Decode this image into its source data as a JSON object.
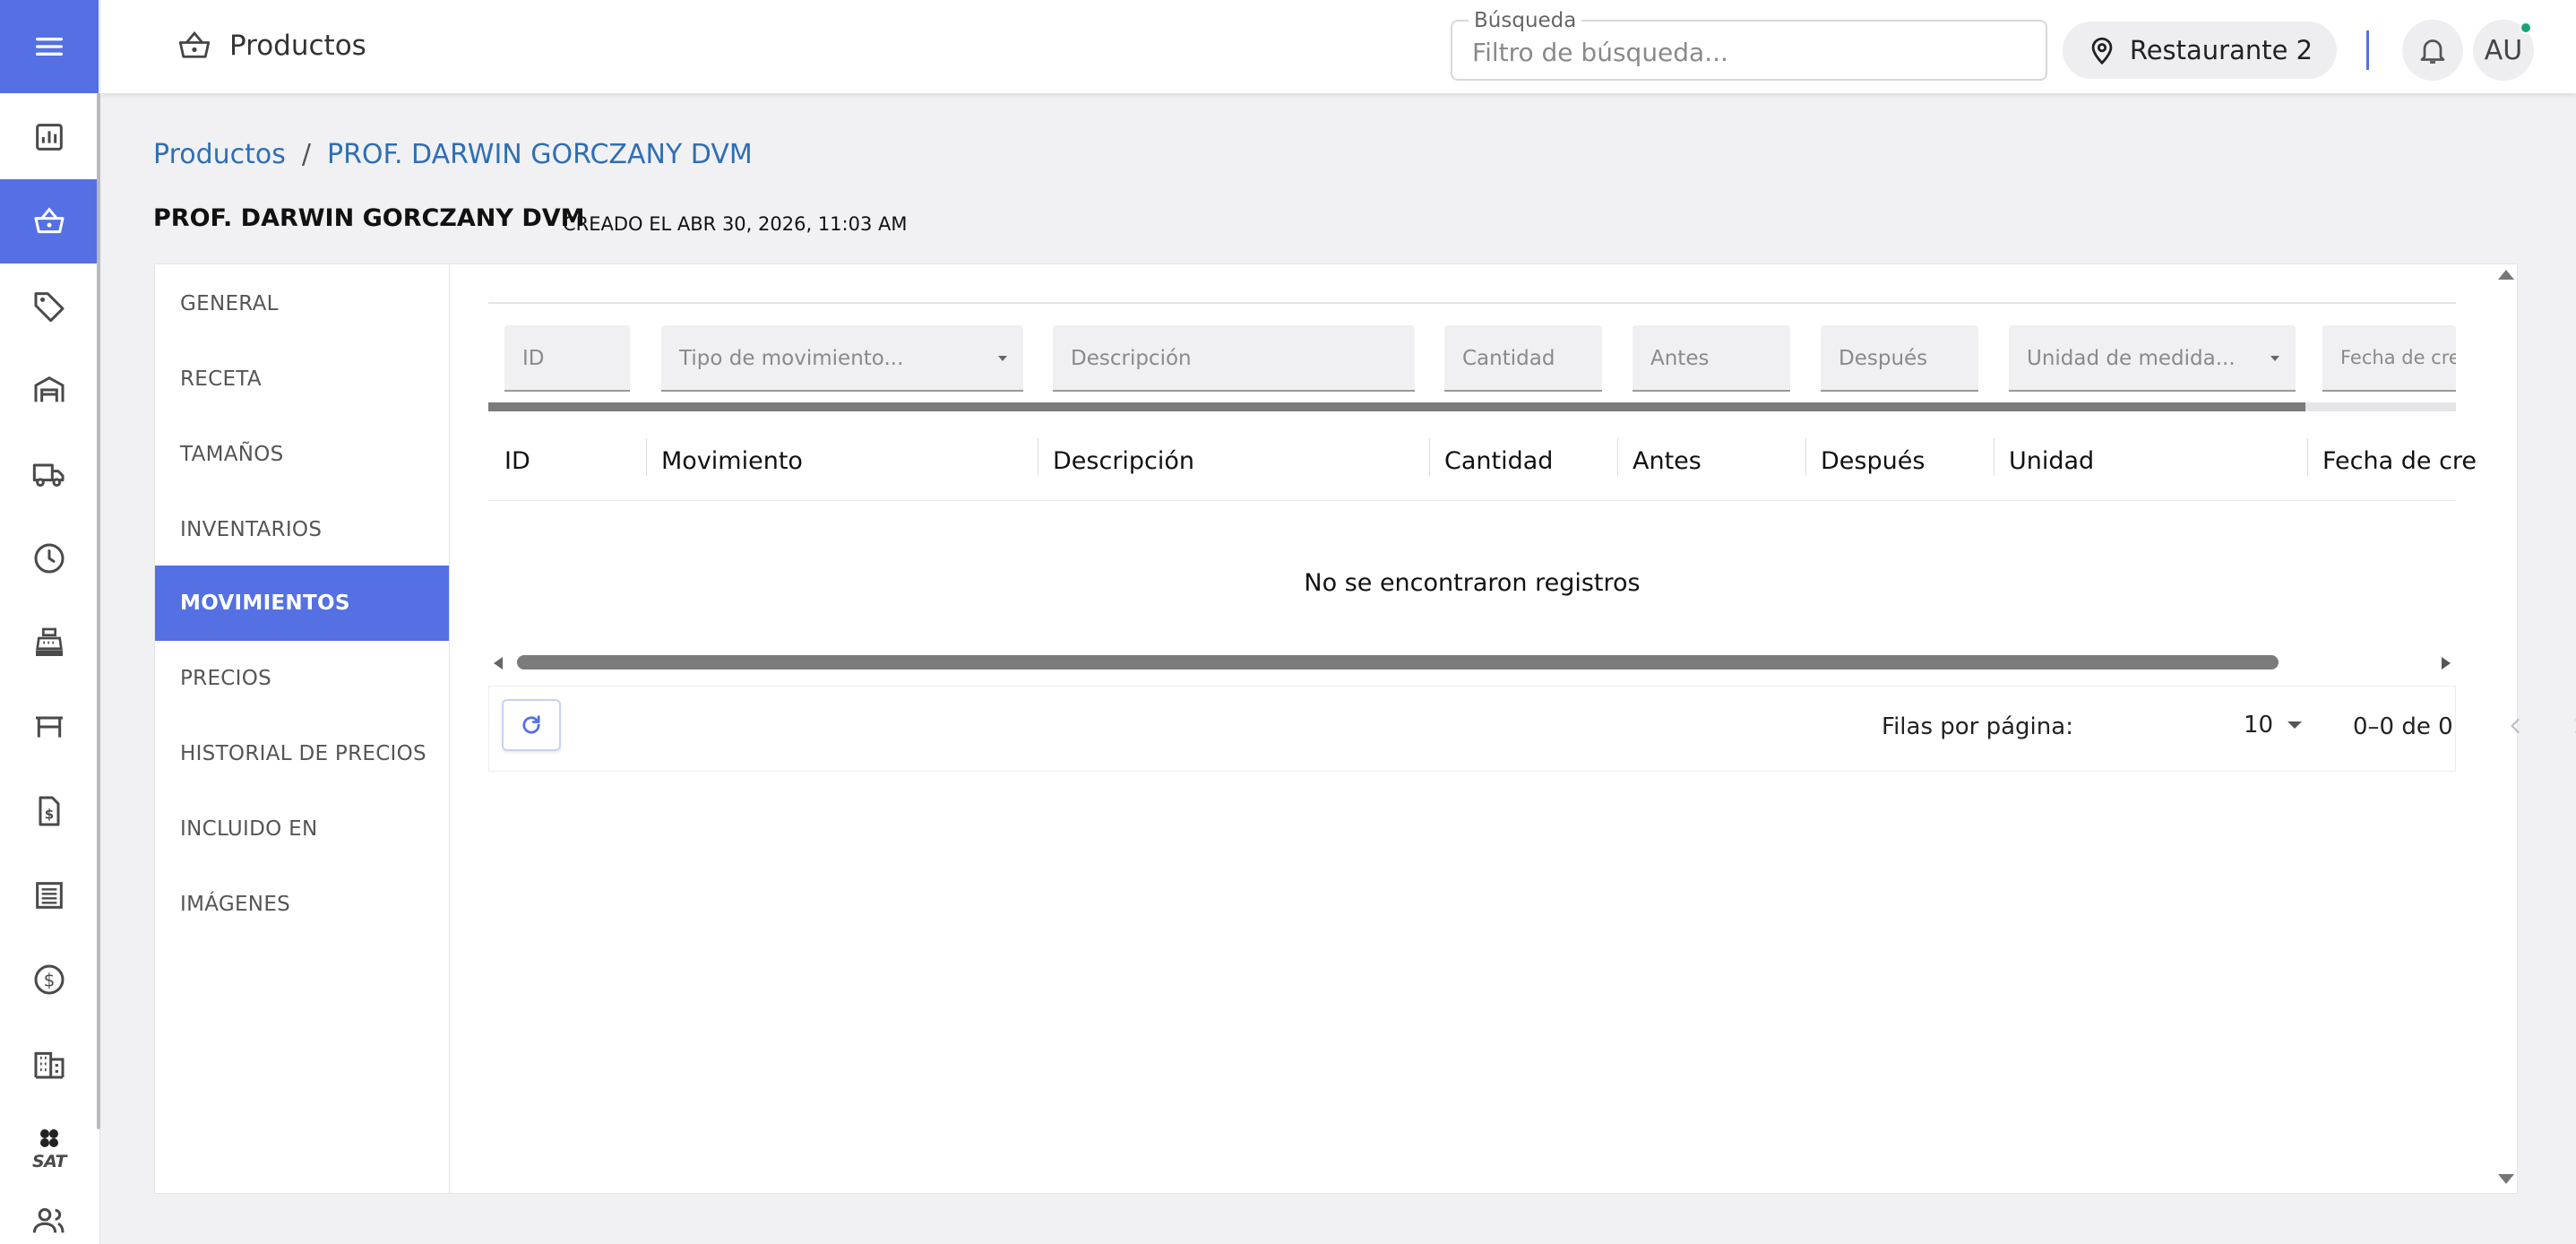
{
  "topbar": {
    "section_title": "Productos",
    "search": {
      "label": "Búsqueda",
      "placeholder": "Filtro de búsqueda..."
    },
    "location": "Restaurante 2",
    "avatar_initials": "AU"
  },
  "sidebar": {
    "items": [
      {
        "icon": "menu-icon",
        "active": false
      },
      {
        "icon": "chart-icon",
        "active": false
      },
      {
        "icon": "basket-icon",
        "active": true
      },
      {
        "icon": "tag-icon",
        "active": false
      },
      {
        "icon": "warehouse-icon",
        "active": false
      },
      {
        "icon": "truck-icon",
        "active": false
      },
      {
        "icon": "clock-icon",
        "active": false
      },
      {
        "icon": "cash-register-icon",
        "active": false
      },
      {
        "icon": "table-icon",
        "active": false
      },
      {
        "icon": "invoice-icon",
        "active": false
      },
      {
        "icon": "list-icon",
        "active": false
      },
      {
        "icon": "dollar-icon",
        "active": false
      },
      {
        "icon": "building-icon",
        "active": false
      },
      {
        "icon": "sat-icon",
        "label": "SAT",
        "active": false
      },
      {
        "icon": "users-icon",
        "active": false
      }
    ]
  },
  "breadcrumb": {
    "root": "Productos",
    "separator": "/",
    "current": "PROF. DARWIN GORCZANY DVM"
  },
  "header": {
    "title": "PROF. DARWIN GORCZANY DVM",
    "created": "CREADO EL ABR 30, 2026, 11:03 AM"
  },
  "tabs": [
    {
      "label": "GENERAL",
      "active": false
    },
    {
      "label": "RECETA",
      "active": false
    },
    {
      "label": "TAMAÑOS",
      "active": false
    },
    {
      "label": "INVENTARIOS",
      "active": false
    },
    {
      "label": "MOVIMIENTOS",
      "active": true
    },
    {
      "label": "PRECIOS",
      "active": false
    },
    {
      "label": "HISTORIAL DE PRECIOS",
      "active": false
    },
    {
      "label": "INCLUIDO EN",
      "active": false
    },
    {
      "label": "IMÁGENES",
      "active": false
    }
  ],
  "filters": [
    {
      "placeholder": "ID",
      "select": false
    },
    {
      "placeholder": "Tipo de movimiento...",
      "select": true
    },
    {
      "placeholder": "Descripción",
      "select": false
    },
    {
      "placeholder": "Cantidad",
      "select": false
    },
    {
      "placeholder": "Antes",
      "select": false
    },
    {
      "placeholder": "Después",
      "select": false
    },
    {
      "placeholder": "Unidad de medida...",
      "select": true
    },
    {
      "placeholder": "Fecha de crea",
      "select": false
    }
  ],
  "table": {
    "columns": [
      "ID",
      "Movimiento",
      "Descripción",
      "Cantidad",
      "Antes",
      "Después",
      "Unidad",
      "Fecha de cre"
    ],
    "rows": [],
    "empty_message": "No se encontraron registros"
  },
  "pagination": {
    "rows_per_page_label": "Filas por página:",
    "rows_per_page": "10",
    "range": "0–0 de 0"
  },
  "colors": {
    "accent": "#5470e3",
    "link": "#2f6fb4",
    "status_dot": "#1aa37a"
  }
}
